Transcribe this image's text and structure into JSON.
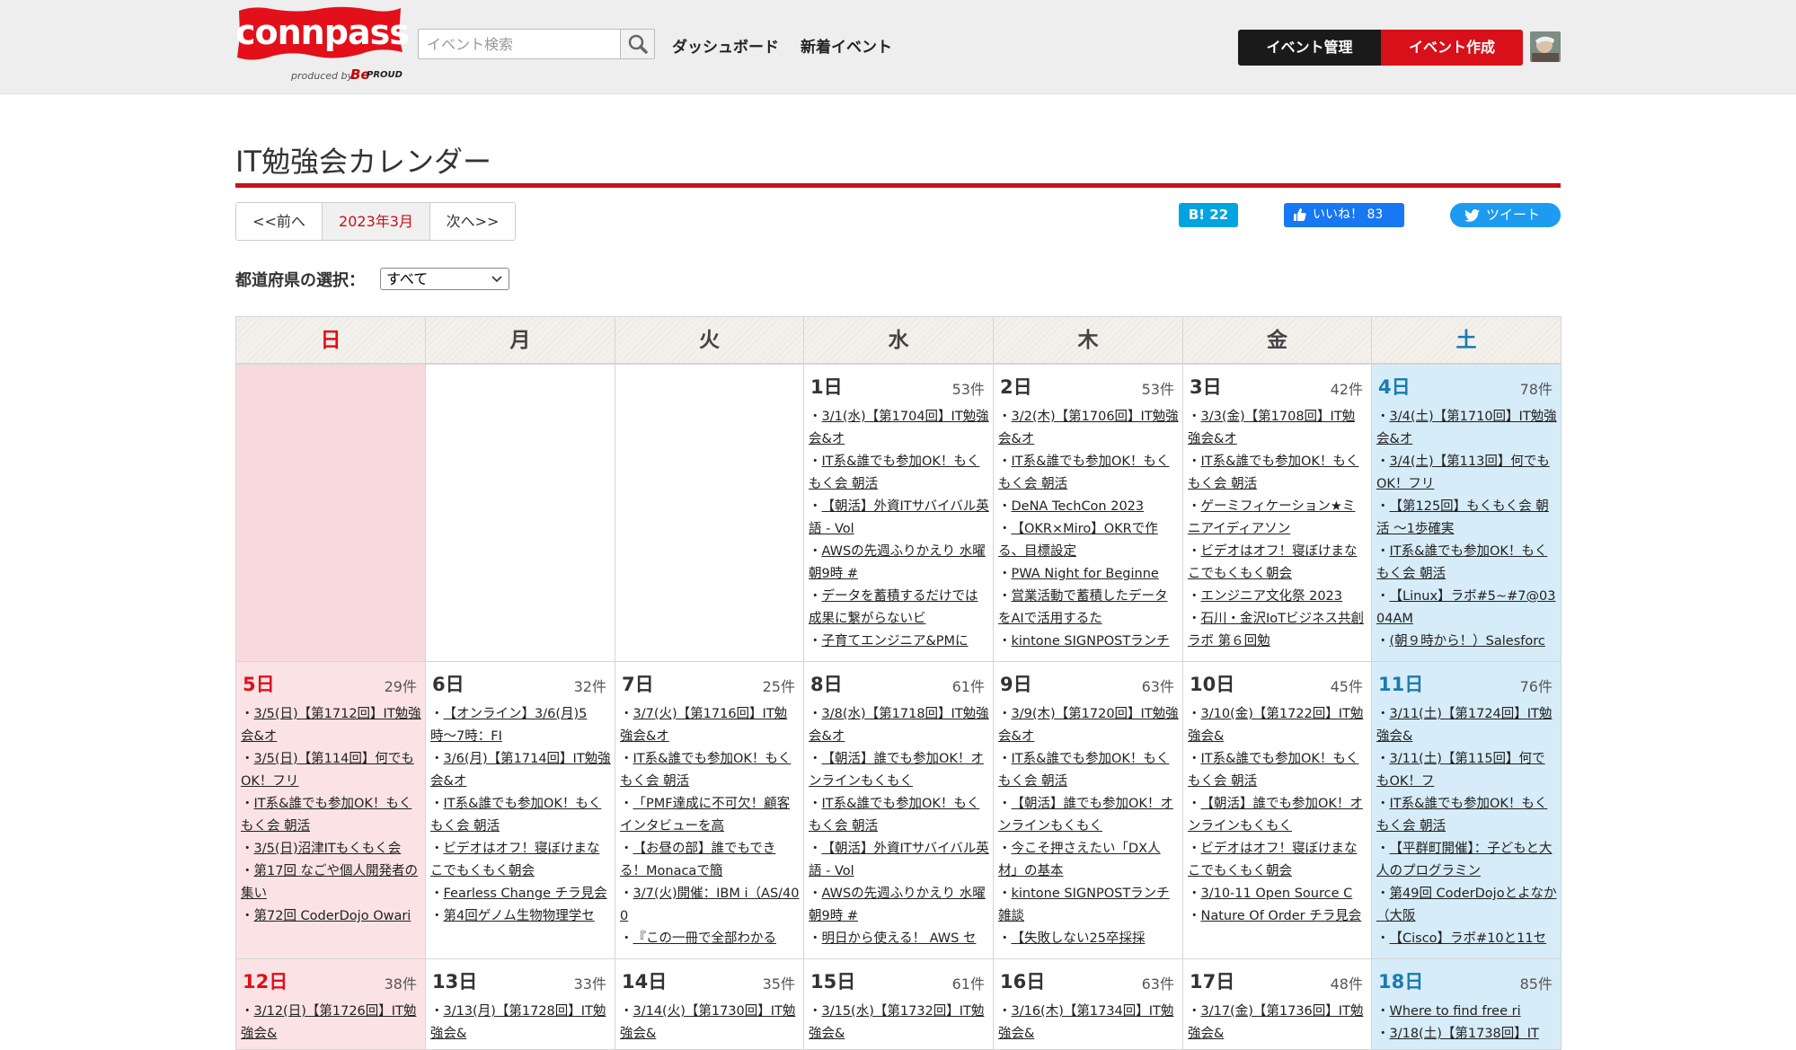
{
  "header": {
    "logo_text": "connpass",
    "logo_sub": "produced by",
    "logo_brand": "Be",
    "logo_brand2": "PROUD",
    "search_placeholder": "イベント検索",
    "nav": [
      "ダッシュボード",
      "新着イベント"
    ],
    "manage_label": "イベント管理",
    "create_label": "イベント作成"
  },
  "page": {
    "title": "IT勉強会カレンダー",
    "prev": "<<前へ",
    "current_month": "2023年3月",
    "next": "次へ>>",
    "pref_label": "都道府県の選択：",
    "pref_value": "すべて"
  },
  "share": {
    "hatena": "B! 22",
    "facebook": "いいね！ 83",
    "twitter": "ツイート"
  },
  "weekdays": [
    "日",
    "月",
    "火",
    "水",
    "木",
    "金",
    "土"
  ],
  "weeks": [
    [
      null,
      null,
      null,
      {
        "day": "1日",
        "count": "53件",
        "events": [
          "3/1(水)【第1704回】IT勉強会&オ",
          "IT系&誰でも参加OK！もくもく会 朝活 ",
          "【朝活】外資ITサバイバル英語 - Vol",
          "AWSの先週ふりかえり 水曜朝9時 #",
          "データを蓄積するだけでは成果に繋がらないビ",
          "子育てエンジニア&PMに"
        ]
      },
      {
        "day": "2日",
        "count": "53件",
        "events": [
          "3/2(木)【第1706回】IT勉強会&オ",
          "IT系&誰でも参加OK！もくもく会 朝活 ",
          "DeNA TechCon 2023",
          "【OKR×Miro】OKRで作る、目標設定",
          "PWA Night for Beginne",
          "営業活動で蓄積したデータをAIで活用するた",
          "kintone SIGNPOSTランチ"
        ]
      },
      {
        "day": "3日",
        "count": "42件",
        "events": [
          "3/3(金)【第1708回】IT勉強会&オ",
          "IT系&誰でも参加OK！もくもく会 朝活 ",
          "ゲーミフィケーション★ミニアイディアソン",
          "ビデオはオフ！寝ぼけまなこでもくもく朝会",
          "エンジニア文化祭 2023",
          "石川・金沢IoTビジネス共創ラボ 第６回勉"
        ]
      },
      {
        "day": "4日",
        "count": "78件",
        "events": [
          "3/4(土)【第1710回】IT勉強会&オ",
          "3/4(土)【第113回】何でもOK！フリ",
          "【第125回】もくもく会 朝活 〜1歩確実",
          "IT系&誰でも参加OK！もくもく会 朝活 ",
          "【Linux】ラボ#5~#7@0304AM",
          "(朝９時から！）Salesforc"
        ]
      }
    ],
    [
      {
        "day": "5日",
        "count": "29件",
        "events": [
          "3/5(日)【第1712回】IT勉強会&オ",
          "3/5(日)【第114回】何でもOK！フリ",
          "IT系&誰でも参加OK！もくもく会 朝活 ",
          "3/5(日)沼津ITもくもく会",
          "第17回 なごや個人開発者の集い",
          "第72回 CoderDojo Owari"
        ]
      },
      {
        "day": "6日",
        "count": "32件",
        "events": [
          "【オンライン】3/6(月)5時〜7時：FI",
          "3/6(月)【第1714回】IT勉強会&オ",
          "IT系&誰でも参加OK！もくもく会 朝活 ",
          "ビデオはオフ！寝ぼけまなこでもくもく朝会",
          "Fearless Change チラ見会",
          "第4回ゲノム生物物理学セ"
        ]
      },
      {
        "day": "7日",
        "count": "25件",
        "events": [
          "3/7(火)【第1716回】IT勉強会&オ",
          "IT系&誰でも参加OK！もくもく会 朝活 ",
          "「PMF達成に不可欠！顧客インタビューを高",
          "【お昼の部】誰でもできる！Monacaで簡",
          "3/7(火)開催：IBM i（AS/400",
          "『この一冊で全部わかる"
        ]
      },
      {
        "day": "8日",
        "count": "61件",
        "events": [
          "3/8(水)【第1718回】IT勉強会&オ",
          "【朝活】誰でも参加OK！オンラインもくもく",
          "IT系&誰でも参加OK！もくもく会 朝活 ",
          "【朝活】外資ITサバイバル英語 - Vol",
          "AWSの先週ふりかえり 水曜朝9時 #",
          "明日から使える！ AWS セ"
        ]
      },
      {
        "day": "9日",
        "count": "63件",
        "events": [
          "3/9(木)【第1720回】IT勉強会&オ",
          "IT系&誰でも参加OK！もくもく会 朝活 ",
          "【朝活】誰でも参加OK！オンラインもくもく",
          "今こそ押さえたい「DX人材」の基本",
          "kintone SIGNPOSTランチ雑談",
          "【失敗しない25卒採採"
        ]
      },
      {
        "day": "10日",
        "count": "45件",
        "events": [
          "3/10(金)【第1722回】IT勉強会&",
          "IT系&誰でも参加OK！もくもく会 朝活 ",
          "【朝活】誰でも参加OK！オンラインもくもく",
          "ビデオはオフ！寝ぼけまなこでもくもく朝会",
          "3/10-11 Open Source C",
          "Nature Of Order チラ見会"
        ]
      },
      {
        "day": "11日",
        "count": "76件",
        "events": [
          "3/11(土)【第1724回】IT勉強会&",
          "3/11(土)【第115回】何でもOK！フ",
          "IT系&誰でも参加OK！もくもく会 朝活 ",
          "【平群町開催】：子どもと大人のプログラミン",
          "第49回 CoderDojoとよなか（大阪",
          "【Cisco】ラボ#10と11セ"
        ]
      }
    ],
    [
      {
        "day": "12日",
        "count": "38件",
        "events": [
          "3/12(日)【第1726回】IT勉強会&"
        ]
      },
      {
        "day": "13日",
        "count": "33件",
        "events": [
          "3/13(月)【第1728回】IT勉強会&"
        ]
      },
      {
        "day": "14日",
        "count": "35件",
        "events": [
          "3/14(火)【第1730回】IT勉強会&"
        ]
      },
      {
        "day": "15日",
        "count": "61件",
        "events": [
          "3/15(水)【第1732回】IT勉強会&"
        ]
      },
      {
        "day": "16日",
        "count": "63件",
        "events": [
          "3/16(木)【第1734回】IT勉強会&"
        ]
      },
      {
        "day": "17日",
        "count": "48件",
        "events": [
          "3/17(金)【第1736回】IT勉強会&"
        ]
      },
      {
        "day": "18日",
        "count": "85件",
        "events": [
          "Where to find free ri",
          "3/18(土)【第1738回】IT"
        ]
      }
    ]
  ]
}
